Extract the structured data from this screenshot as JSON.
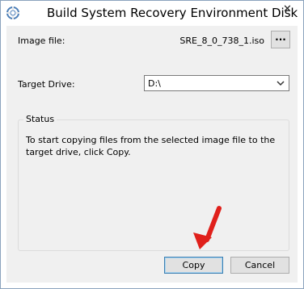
{
  "window": {
    "title": "Build System Recovery Environment Disk",
    "close_glyph": "✕"
  },
  "image_file": {
    "label": "Image file:",
    "value": "SRE_8_0_738_1.iso",
    "browse_label": "..."
  },
  "target_drive": {
    "label": "Target Drive:",
    "selected": "D:\\"
  },
  "status": {
    "legend": "Status",
    "message": "To start copying files from the selected image file to the target drive, click Copy."
  },
  "buttons": {
    "copy": "Copy",
    "cancel": "Cancel"
  },
  "annotation": {
    "arrow_color": "#e0201b"
  }
}
